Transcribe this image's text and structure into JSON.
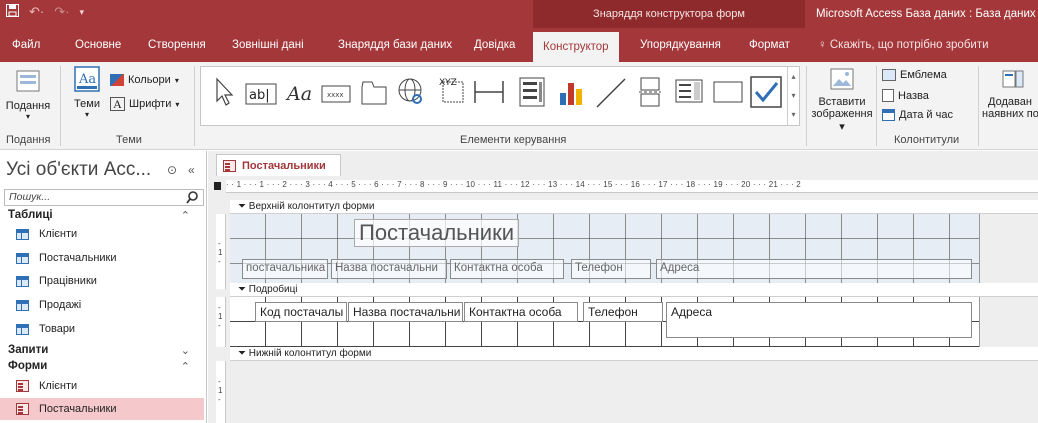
{
  "titlebar": {
    "contextual_label": "Знаряддя конструктора форм",
    "app_title": "Microsoft Access База даних : База даних"
  },
  "tabs": [
    {
      "label": "Файл"
    },
    {
      "label": "Основне"
    },
    {
      "label": "Створення"
    },
    {
      "label": "Зовнішні дані"
    },
    {
      "label": "Знаряддя бази даних"
    },
    {
      "label": "Довідка"
    },
    {
      "label": "Конструктор"
    },
    {
      "label": "Упорядкування"
    },
    {
      "label": "Формат"
    }
  ],
  "tellme": "Скажіть, що потрібно зробити",
  "ribbon": {
    "views_button": "Подання",
    "views_group": "Подання",
    "themes_button": "Теми",
    "colors_button": "Кольори",
    "fonts_button": "Шрифти",
    "themes_group": "Теми",
    "controls_group": "Елементи керування",
    "insert_image_line1": "Вставити",
    "insert_image_line2": "зображення",
    "logo_button": "Емблема",
    "title_button": "Назва",
    "datetime_button": "Дата й час",
    "header_footer_group": "Колонтитули",
    "add_existing_line1": "Додаван",
    "add_existing_line2": "наявних по"
  },
  "nav": {
    "title": "Усі об'єкти Acc...",
    "search_placeholder": "Пошук...",
    "sections": [
      {
        "label": "Таблиці",
        "chevron": "⌃",
        "items": [
          "Клієнти",
          "Постачальники",
          "Працівники",
          "Продажі",
          "Товари"
        ]
      },
      {
        "label": "Запити",
        "chevron": "⌄",
        "items": []
      },
      {
        "label": "Форми",
        "chevron": "⌃",
        "items": [
          "Клієнти",
          "Постачальники"
        ]
      }
    ]
  },
  "document": {
    "tab_label": "Постачальники",
    "ruler_text": "· · 1 · · · 1 · · · 2 · · · 3 · · · 4 · · · 5 · · · 6 · · · 7 · · · 8 · · · 9 · · · 10 · · · 11 · · · 12 · · · 13 · · · 14 · · · 15 · · · 16 · · · 17 · · · 18 · · · 19 · · · 20 · · · 21 · · · 2",
    "header_section": "Верхній колонтитул форми",
    "detail_section": "Подробиці",
    "footer_section": "Нижній колонтитул форми",
    "form_title": "Постачальники",
    "header_labels": [
      "постачальника",
      "Назва постачальни",
      "Контактна особа",
      "Телефон",
      "Адреса"
    ],
    "detail_fields": [
      "Код постачалы",
      "Назва постачальни",
      "Контактна особа",
      "Телефон",
      "Адреса"
    ]
  }
}
